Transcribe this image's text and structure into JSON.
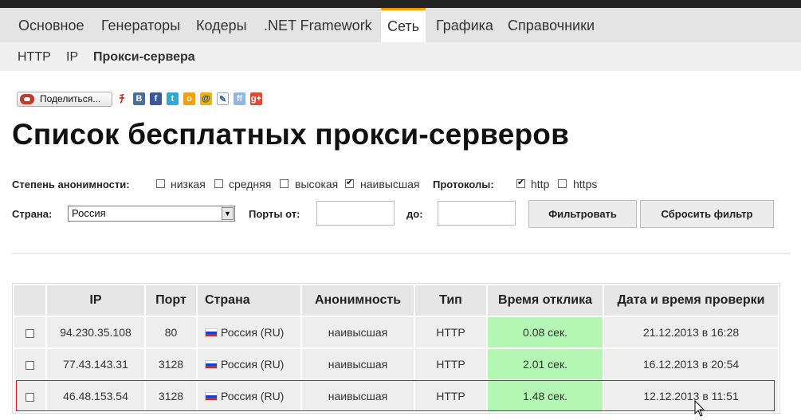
{
  "nav": {
    "items": [
      {
        "label": "Основное"
      },
      {
        "label": "Генераторы"
      },
      {
        "label": "Кодеры"
      },
      {
        "label": ".NET Framework"
      },
      {
        "label": "Сеть",
        "active": true
      },
      {
        "label": "Графика"
      },
      {
        "label": "Справочники"
      }
    ],
    "active_accent": "#f5a000"
  },
  "subnav": {
    "items": [
      {
        "label": "HTTP"
      },
      {
        "label": "IP"
      },
      {
        "label": "Прокси-сервера",
        "active": true
      }
    ]
  },
  "share": {
    "button_label": "Поделиться...",
    "icons": [
      "blog-icon",
      "vk-icon",
      "facebook-icon",
      "twitter-icon",
      "odnoklassniki-icon",
      "mailru-icon",
      "livejournal-icon",
      "friendfeed-icon",
      "google-plus-icon"
    ]
  },
  "page_title": "Список бесплатных прокси-серверов",
  "filters": {
    "anonymity_label": "Степень анонимности:",
    "anonymity_options": [
      {
        "label": "низкая",
        "checked": false
      },
      {
        "label": "средняя",
        "checked": false
      },
      {
        "label": "высокая",
        "checked": false
      },
      {
        "label": "наивысшая",
        "checked": true
      }
    ],
    "protocols_label": "Протоколы:",
    "protocol_options": [
      {
        "label": "http",
        "checked": true
      },
      {
        "label": "https",
        "checked": false
      }
    ],
    "country_label": "Страна:",
    "country_value": "Россия",
    "ports_from_label": "Порты от:",
    "ports_from_value": "",
    "ports_to_label": "до:",
    "ports_to_value": "",
    "filter_button": "Фильтровать",
    "reset_button": "Сбросить фильтр"
  },
  "table": {
    "headers": [
      "",
      "IP",
      "Порт",
      "Страна",
      "Анонимность",
      "Тип",
      "Время отклика",
      "Дата и время проверки"
    ],
    "rows": [
      {
        "ip": "94.230.35.108",
        "port": "80",
        "country": "Россия (RU)",
        "anonymity": "наивысшая",
        "type": "HTTP",
        "response": "0.08 сек.",
        "checked_at": "21.12.2013 в 16:28"
      },
      {
        "ip": "77.43.143.31",
        "port": "3128",
        "country": "Россия (RU)",
        "anonymity": "наивысшая",
        "type": "HTTP",
        "response": "2.01 сек.",
        "checked_at": "16.12.2013 в 20:54"
      },
      {
        "ip": "46.48.153.54",
        "port": "3128",
        "country": "Россия (RU)",
        "anonymity": "наивысшая",
        "type": "HTTP",
        "response": "1.48 сек.",
        "checked_at": "12.12.2013 в 11:51"
      }
    ],
    "response_color": "#b4f7b4",
    "highlight_color": "#d41616"
  }
}
